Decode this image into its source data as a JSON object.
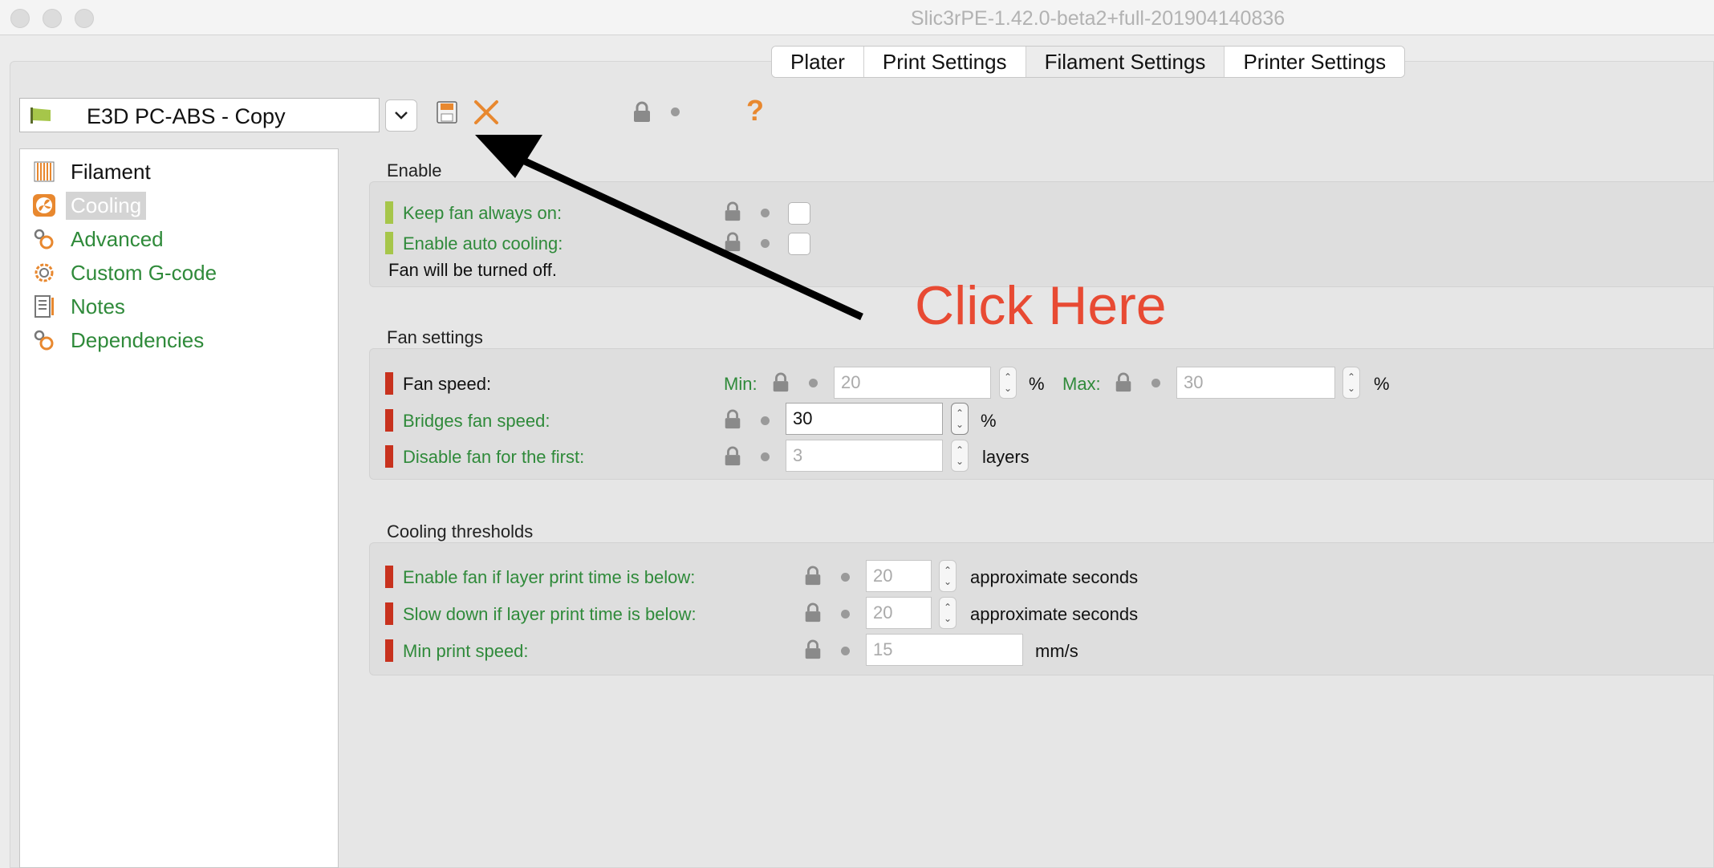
{
  "window": {
    "title": "Slic3rPE-1.42.0-beta2+full-201904140836"
  },
  "tabs": [
    {
      "label": "Plater"
    },
    {
      "label": "Print Settings"
    },
    {
      "label": "Filament Settings",
      "active": true
    },
    {
      "label": "Printer Settings"
    }
  ],
  "preset": {
    "name": "E3D PC-ABS - Copy",
    "help": "?"
  },
  "sidebar": {
    "items": [
      {
        "label": "Filament",
        "icon": "filament-icon"
      },
      {
        "label": "Cooling",
        "icon": "cooling-fan-icon",
        "selected": true
      },
      {
        "label": "Advanced",
        "icon": "gears-icon"
      },
      {
        "label": "Custom G-code",
        "icon": "gear-icon"
      },
      {
        "label": "Notes",
        "icon": "notes-icon"
      },
      {
        "label": "Dependencies",
        "icon": "gears-icon"
      }
    ]
  },
  "enable": {
    "title": "Enable",
    "keep_fan_label": "Keep fan always on:",
    "keep_fan_checked": false,
    "auto_cooling_label": "Enable auto cooling:",
    "auto_cooling_checked": false,
    "note": "Fan will be turned off."
  },
  "fan_settings": {
    "title": "Fan settings",
    "fan_speed_label": "Fan speed:",
    "min_label": "Min:",
    "min_value": "20",
    "max_label": "Max:",
    "max_value": "30",
    "percent": "%",
    "bridges_label": "Bridges fan speed:",
    "bridges_value": "30",
    "disable_label": "Disable fan for the first:",
    "disable_value": "3",
    "layers": "layers"
  },
  "thresholds": {
    "title": "Cooling thresholds",
    "enable_fan_label": "Enable fan if layer print time is below:",
    "enable_fan_value": "20",
    "slow_down_label": "Slow down if layer print time is below:",
    "slow_down_value": "20",
    "approx_seconds": "approximate seconds",
    "min_speed_label": "Min print speed:",
    "min_speed_value": "15",
    "mms": "mm/s"
  },
  "annotation": {
    "text": "Click Here"
  },
  "colors": {
    "accent_green": "#2f8a3a",
    "status_red": "#c8321e",
    "status_green": "#a6c64a",
    "annotation_red": "#e84a33",
    "icon_orange": "#e8882f"
  }
}
